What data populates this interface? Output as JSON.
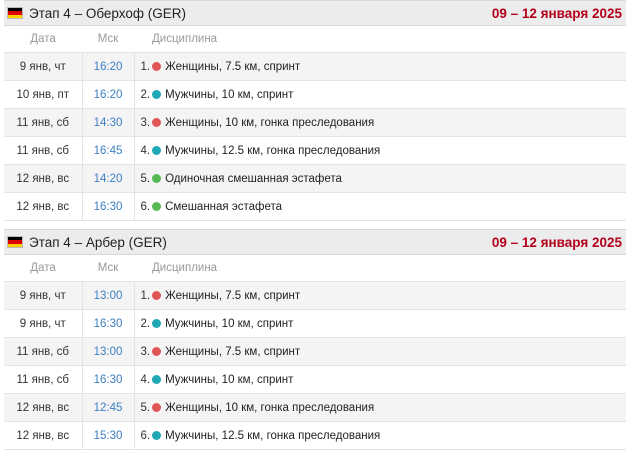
{
  "colors": {
    "women": "#e05656",
    "men": "#1fa8b5",
    "mixed": "#57b956",
    "dates": "#b3001b",
    "time": "#3a7fc1"
  },
  "stages": [
    {
      "flag": "germany-flag-icon",
      "title": "Этап 4 – Оберхоф (GER)",
      "dates": "09 – 12 января 2025",
      "headers": {
        "date": "Дата",
        "time": "Мск",
        "discipline": "Дисциплина"
      },
      "rows": [
        {
          "date": "9 янв, чт",
          "time": "16:20",
          "num": "1.",
          "dot": "red",
          "discipline": "Женщины, 7.5 км, спринт"
        },
        {
          "date": "10 янв, пт",
          "time": "16:20",
          "num": "2.",
          "dot": "teal",
          "discipline": "Мужчины, 10 км, спринт"
        },
        {
          "date": "11 янв, сб",
          "time": "14:30",
          "num": "3.",
          "dot": "red",
          "discipline": "Женщины, 10 км, гонка преследования"
        },
        {
          "date": "11 янв, сб",
          "time": "16:45",
          "num": "4.",
          "dot": "teal",
          "discipline": "Мужчины, 12.5 км, гонка преследования"
        },
        {
          "date": "12 янв, вс",
          "time": "14:20",
          "num": "5.",
          "dot": "green",
          "discipline": "Одиночная смешанная эстафета"
        },
        {
          "date": "12 янв, вс",
          "time": "16:30",
          "num": "6.",
          "dot": "green",
          "discipline": "Смешанная эстафета"
        }
      ]
    },
    {
      "flag": "germany-flag-icon",
      "title": "Этап 4 – Арбер (GER)",
      "dates": "09 – 12 января 2025",
      "headers": {
        "date": "Дата",
        "time": "Мск",
        "discipline": "Дисциплина"
      },
      "rows": [
        {
          "date": "9 янв, чт",
          "time": "13:00",
          "num": "1.",
          "dot": "red",
          "discipline": "Женщины, 7.5 км, спринт"
        },
        {
          "date": "9 янв, чт",
          "time": "16:30",
          "num": "2.",
          "dot": "teal",
          "discipline": "Мужчины, 10 км, спринт"
        },
        {
          "date": "11 янв, сб",
          "time": "13:00",
          "num": "3.",
          "dot": "red",
          "discipline": "Женщины, 7.5 км, спринт"
        },
        {
          "date": "11 янв, сб",
          "time": "16:30",
          "num": "4.",
          "dot": "teal",
          "discipline": "Мужчины, 10 км, спринт"
        },
        {
          "date": "12 янв, вс",
          "time": "12:45",
          "num": "5.",
          "dot": "red",
          "discipline": "Женщины, 10 км, гонка преследования"
        },
        {
          "date": "12 янв, вс",
          "time": "15:30",
          "num": "6.",
          "dot": "teal",
          "discipline": "Мужчины, 12.5 км, гонка преследования"
        }
      ]
    }
  ]
}
